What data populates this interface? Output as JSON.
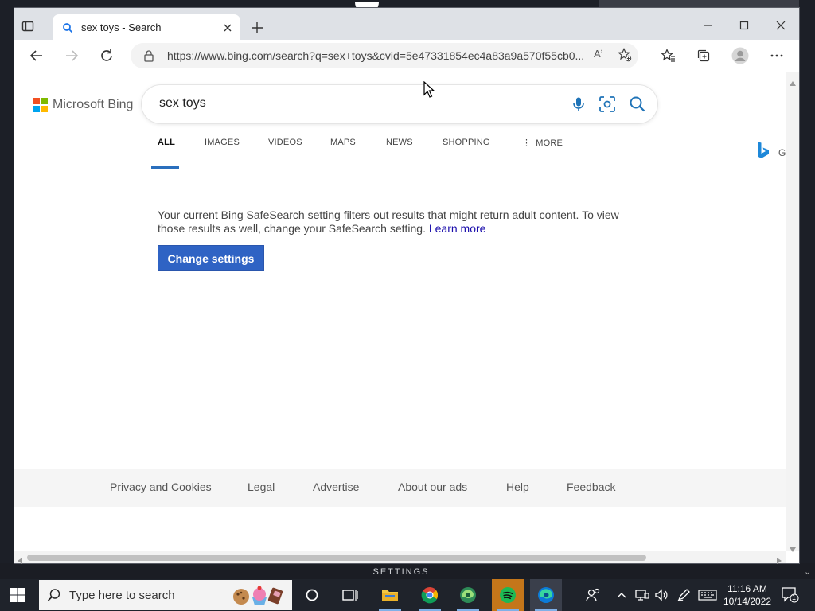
{
  "browser": {
    "tab_title": "sex toys - Search",
    "url": "https://www.bing.com/search?q=sex+toys&cvid=5e47331854ec4a83a9a570f55cb0...",
    "read_aloud_label": "Aʼ"
  },
  "bing": {
    "logo_text": "Microsoft Bing",
    "query": "sex toys",
    "scopes": {
      "all": "ALL",
      "images": "IMAGES",
      "videos": "VIDEOS",
      "maps": "MAPS",
      "news": "NEWS",
      "shopping": "SHOPPING",
      "more": "MORE"
    },
    "side_letter": "G",
    "notice": "Your current Bing SafeSearch setting filters out results that might return adult content. To view those results as well, change your SafeSearch setting.",
    "learn_more": "Learn more",
    "change_settings": "Change settings",
    "footer": {
      "privacy": "Privacy and Cookies",
      "legal": "Legal",
      "advertise": "Advertise",
      "about_ads": "About our ads",
      "help": "Help",
      "feedback": "Feedback"
    },
    "logo_colors": [
      "#f25022",
      "#7fba00",
      "#00a4ef",
      "#ffb900"
    ],
    "accent": "#2f63c4"
  },
  "overlay": {
    "settings_label": "SETTINGS"
  },
  "taskbar": {
    "search_placeholder": "Type here to search",
    "time": "11:16 AM",
    "date": "10/14/2022",
    "notification_count": "1",
    "icons": [
      "windows-start-icon",
      "cortana-icon",
      "task-view-icon",
      "file-explorer-icon",
      "chrome-icon",
      "edge-beta-icon",
      "spotify-icon",
      "edge-icon",
      "people-icon",
      "chevron-up-icon",
      "network-icon",
      "volume-icon",
      "pen-icon",
      "keyboard-icon",
      "notification-icon"
    ]
  }
}
